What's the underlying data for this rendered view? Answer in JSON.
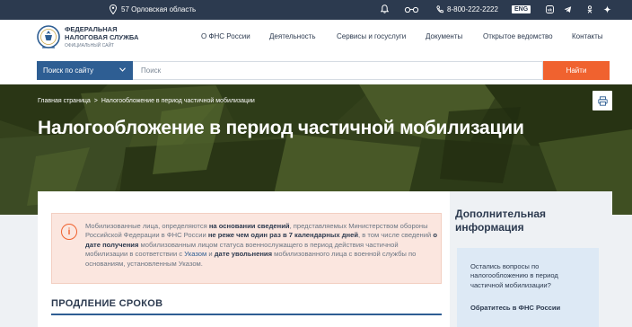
{
  "topbar": {
    "region": "57 Орловская область",
    "phone": "8-800-222-2222",
    "lang": "ENG",
    "icons": [
      "location-pin-icon",
      "bell-icon",
      "glasses-icon",
      "phone-icon",
      "vk-icon",
      "telegram-icon",
      "ok-icon",
      "dzen-icon"
    ]
  },
  "header": {
    "logo_line1": "ФЕДЕРАЛЬНАЯ",
    "logo_line2": "НАЛОГОВАЯ СЛУЖБА",
    "logo_sub": "ОФИЦИАЛЬНЫЙ САЙТ",
    "nav": [
      "О ФНС России",
      "Деятельность",
      "Сервисы и госуслуги",
      "Документы",
      "Открытое ведомство",
      "Контакты"
    ]
  },
  "search": {
    "scope": "Поиск по сайту",
    "placeholder": "Поиск",
    "button": "Найти"
  },
  "breadcrumb": {
    "home": "Главная страница",
    "separator": ">",
    "current": "Налогообложение в период частичной мобилизации"
  },
  "page_title": "Налогообложение в период частичной мобилизации",
  "notice": {
    "t1": "Мобилизованные лица, определяются ",
    "b1": "на основании сведений",
    "t2": ", представляемых Министерством обороны Российской Федерации в ФНС России ",
    "b2": "не реже чем один раз в 7 календарных дней",
    "t3": ", в том числе сведений ",
    "b3": "о дате получения",
    "t4": " мобилизованным лицом статуса военнослужащего в период действия частичной мобилизации в соответствии с ",
    "l1": "Указом",
    "t5": " и ",
    "b4": "дате увольнения",
    "t6": " мобилизованного лица с военной службы по основаниям, установленным Указом."
  },
  "section": {
    "title": "ПРОДЛЕНИЕ СРОКОВ"
  },
  "sidebar": {
    "title_line1": "Дополнительная",
    "title_line2": "информация",
    "question": "Остались вопросы по налогообложению в период частичной мобилизации?",
    "link": "Обратитесь в ФНС России"
  },
  "colors": {
    "topbar": "#2c3a4f",
    "accent_blue": "#2e5e93",
    "accent_orange": "#f0622f",
    "notice_bg": "#fbe6df"
  }
}
